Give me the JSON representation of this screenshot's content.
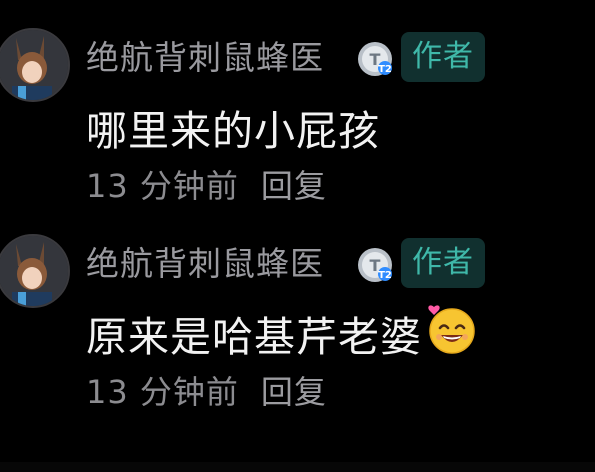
{
  "comments": [
    {
      "username": "绝航背刺鼠蜂医",
      "level_badge": "T2",
      "author_tag": "作者",
      "content": "哪里来的小屁孩",
      "time": "13 分钟前",
      "reply_label": "回复"
    },
    {
      "username": "绝航背刺鼠蜂医",
      "level_badge": "T2",
      "author_tag": "作者",
      "content": "原来是哈基芹老婆",
      "time": "13 分钟前",
      "reply_label": "回复",
      "emoji": "smiling-face-with-heart-emoji"
    }
  ],
  "colors": {
    "background": "#000000",
    "username": "#9a9a9f",
    "author_tag_text": "#3fb8a9",
    "author_tag_bg": "#11302f",
    "content": "#f2f2f2",
    "meta": "#8c8c90"
  }
}
